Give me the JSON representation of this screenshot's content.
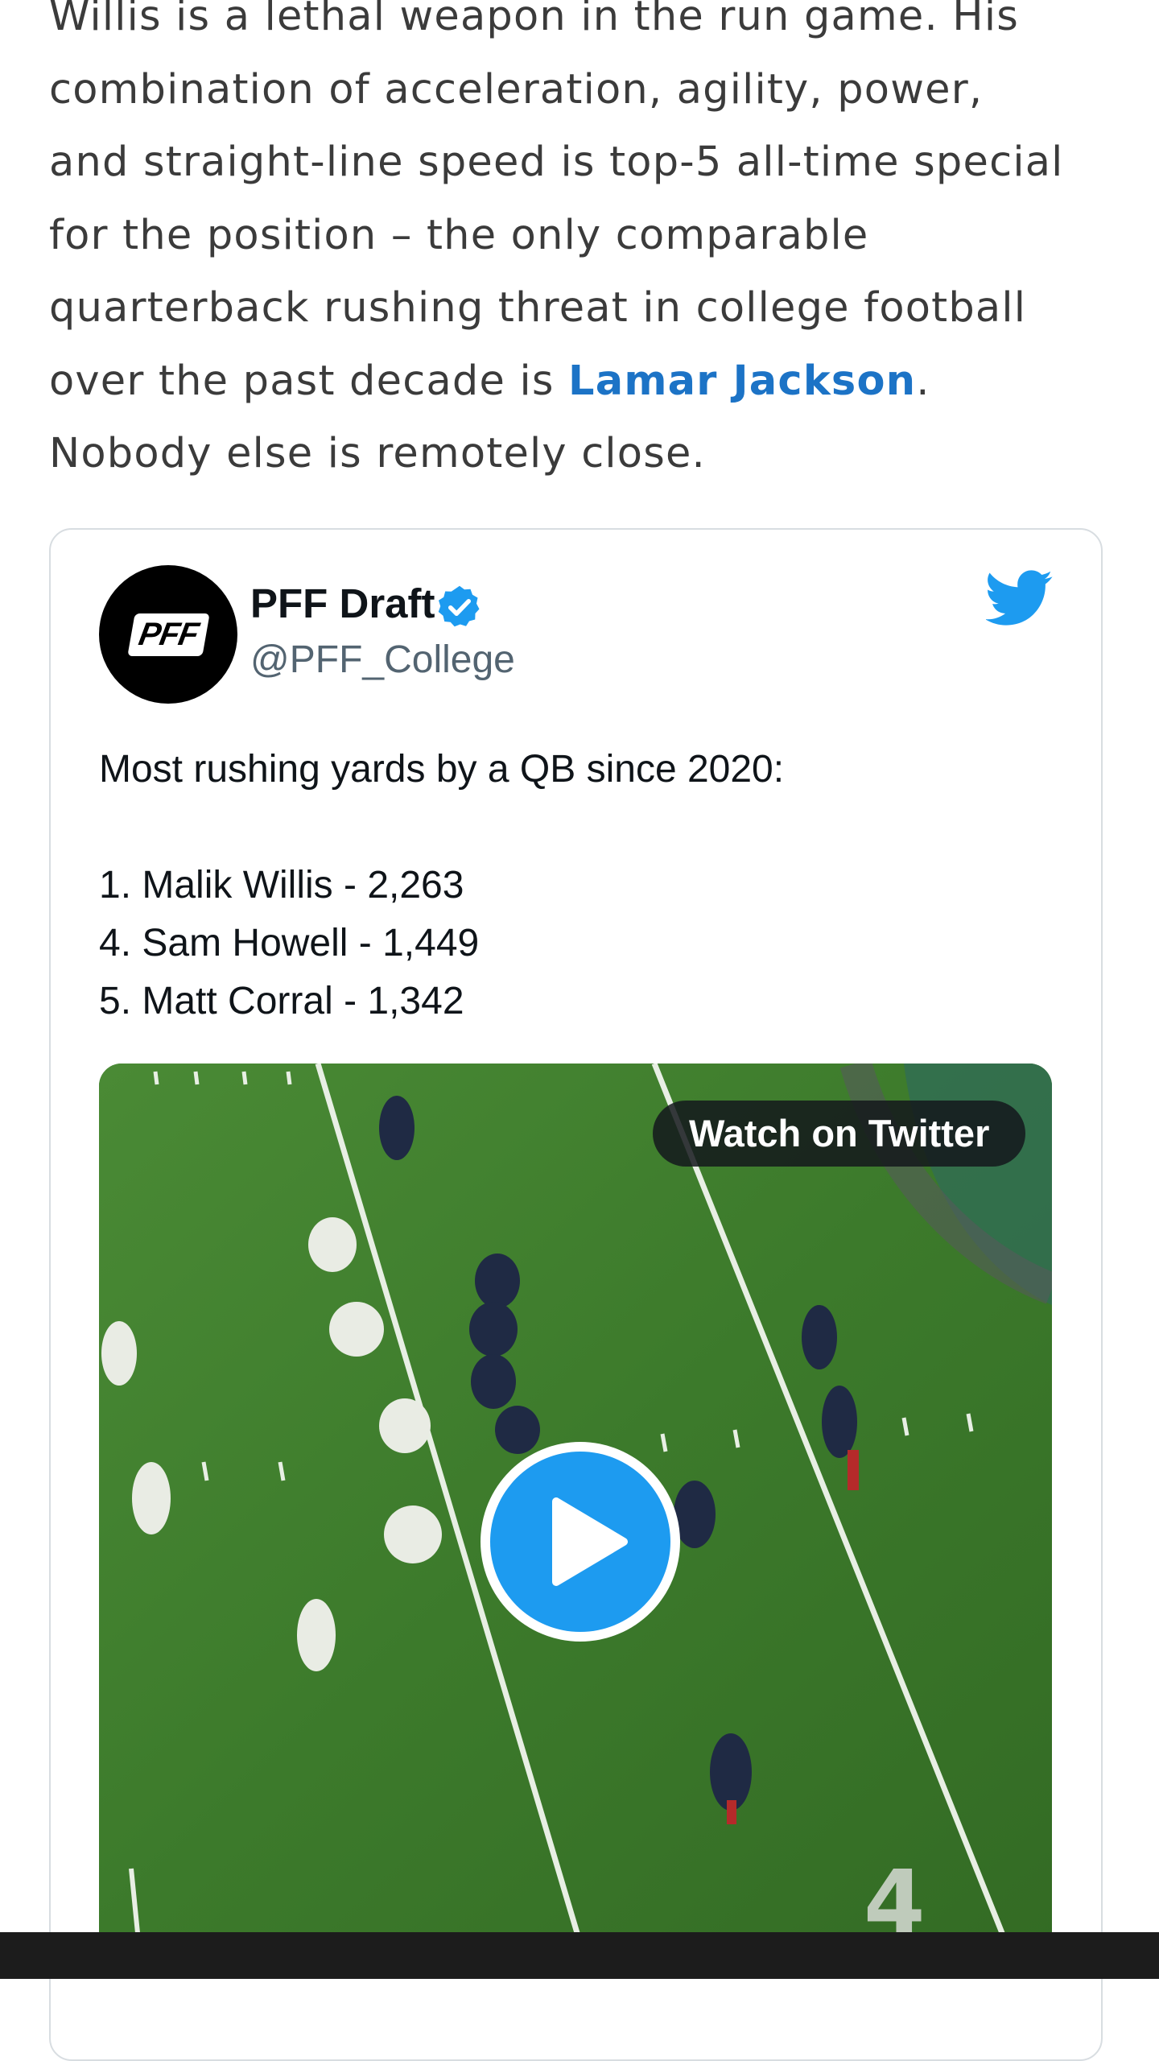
{
  "article": {
    "lines": [
      "Willis is a lethal weapon in the run game. His",
      "combination of acceleration, agility, power,",
      "and straight-line speed is top-5 all-time special",
      "for the position – the only comparable",
      "quarterback rushing threat in college football"
    ],
    "line6_pre": "over the past decade is ",
    "line6_link": "Lamar Jackson",
    "line6_post": ".",
    "line7": "Nobody else is remotely close."
  },
  "tweet": {
    "avatar_text": "PFF",
    "author_name": "PFF Draft",
    "handle": "@PFF_College",
    "text_lines": [
      "Most rushing yards by a QB since 2020:",
      "",
      "1. Malik Willis - 2,263",
      "4. Sam Howell - 1,449",
      "5. Matt Corral - 1,342"
    ],
    "watch_label": "Watch on Twitter"
  },
  "colors": {
    "link": "#1c73c6",
    "twitter_blue": "#1d9bf0",
    "field_green": "#3d7a2c"
  },
  "icons": {
    "verified": "verified-badge-icon",
    "twitter": "twitter-bird-icon",
    "play": "play-icon"
  }
}
